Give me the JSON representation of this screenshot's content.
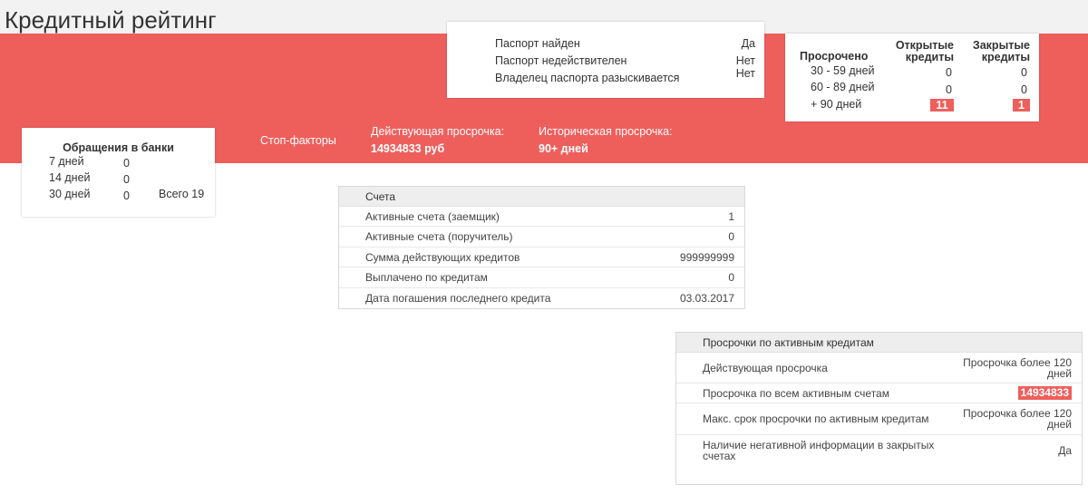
{
  "title": "Кредитный рейтинг",
  "passport": [
    {
      "label": "Паспорт найден",
      "value": "Да"
    },
    {
      "label": "Паспорт недействителен",
      "value": "Нет"
    },
    {
      "label": "Владелец паспорта разыскивается",
      "value": "Нет"
    }
  ],
  "overdue": {
    "header_overdue": "Просрочено",
    "header_open": "Открытые кредиты",
    "header_closed": "Закрытые кредиты",
    "rows": [
      {
        "period": "30 - 59 дней",
        "open": "0",
        "closed": "0"
      },
      {
        "period": "60 - 89 дней",
        "open": "0",
        "closed": "0"
      },
      {
        "period": "+ 90 дней",
        "open": "11",
        "closed": "1"
      }
    ]
  },
  "bank_requests": {
    "title": "Обращения в банки",
    "rows": [
      {
        "period": "7 дней",
        "count": "0"
      },
      {
        "period": "14 дней",
        "count": "0"
      },
      {
        "period": "30 дней",
        "count": "0"
      }
    ],
    "total": "Всего 19"
  },
  "stop_factors": "Стоп-факторы",
  "current_overdue": {
    "label": "Действующая просрочка:",
    "value": "14934833 руб"
  },
  "historical_overdue": {
    "label": "Историческая просрочка:",
    "value": "90+ дней"
  },
  "accounts": {
    "title": "Счета",
    "rows": [
      {
        "label": "Активные счета (заемщик)",
        "value": "1"
      },
      {
        "label": "Активные счета (поручитель)",
        "value": "0"
      },
      {
        "label": "Сумма действующих кредитов",
        "value": "999999999"
      },
      {
        "label": "Выплачено по кредитам",
        "value": "0"
      },
      {
        "label": "Дата погашения последнего кредита",
        "value": "03.03.2017"
      }
    ]
  },
  "active_overdue": {
    "title": "Просрочки по активным кредитам",
    "rows": [
      {
        "label": "Действующая просрочка",
        "value": "Просрочка более 120 дней"
      },
      {
        "label": "Просрочка по всем активным счетам",
        "value": "14934833"
      },
      {
        "label": "Макс. срок просрочки по активным кредитам",
        "value": "Просрочка более 120 дней"
      },
      {
        "label": "Наличие негативной информации в закрытых счетах",
        "value": "Да"
      }
    ]
  },
  "colors": {
    "accent": "#ee5f5c",
    "topbar": "#f2f2f2"
  }
}
